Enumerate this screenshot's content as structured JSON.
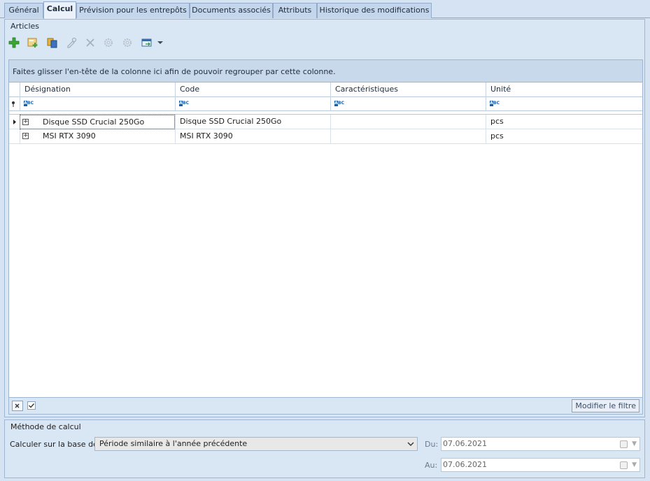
{
  "tabs": [
    {
      "label": "Général",
      "active": false
    },
    {
      "label": "Calcul",
      "active": true
    },
    {
      "label": "Prévision pour les entrepôts",
      "active": false
    },
    {
      "label": "Documents associés",
      "active": false
    },
    {
      "label": "Attributs",
      "active": false
    },
    {
      "label": "Historique des modifications",
      "active": false
    }
  ],
  "articles": {
    "title": "Articles",
    "toolbar": [
      "add-icon",
      "add-from-catalog-icon",
      "copy-icon",
      "edit-icon",
      "delete-icon",
      "settings-icon",
      "settings-alt-icon",
      "export-icon"
    ],
    "group_hint": "Faites glisser l'en-tête de la colonne ici afin de pouvoir regrouper par cette colonne.",
    "columns": [
      "Désignation",
      "Code",
      "Caractéristiques",
      "Unité"
    ],
    "filter_placeholder_icon": "abc-filter-icon",
    "rows": [
      {
        "designation": "Disque SSD Crucial 250Go",
        "code": "Disque SSD Crucial 250Go",
        "caracteristiques": "",
        "unite": "pcs"
      },
      {
        "designation": "MSI RTX 3090",
        "code": "MSI RTX 3090",
        "caracteristiques": "",
        "unite": "pcs"
      }
    ],
    "footer": {
      "filter_button": "Modifier le filtre"
    }
  },
  "methode": {
    "title": "Méthode de calcul",
    "basis_label": "Calculer sur la base de:",
    "basis_value": "Période similaire à l'année précédente",
    "du_label": "Du:",
    "du_value": "07.06.2021",
    "au_label": "Au:",
    "au_value": "07.06.2021"
  },
  "colors": {
    "accent": "#2c9a2c",
    "tab_active": "#eaf1fa",
    "panel": "#d9e6f4"
  }
}
